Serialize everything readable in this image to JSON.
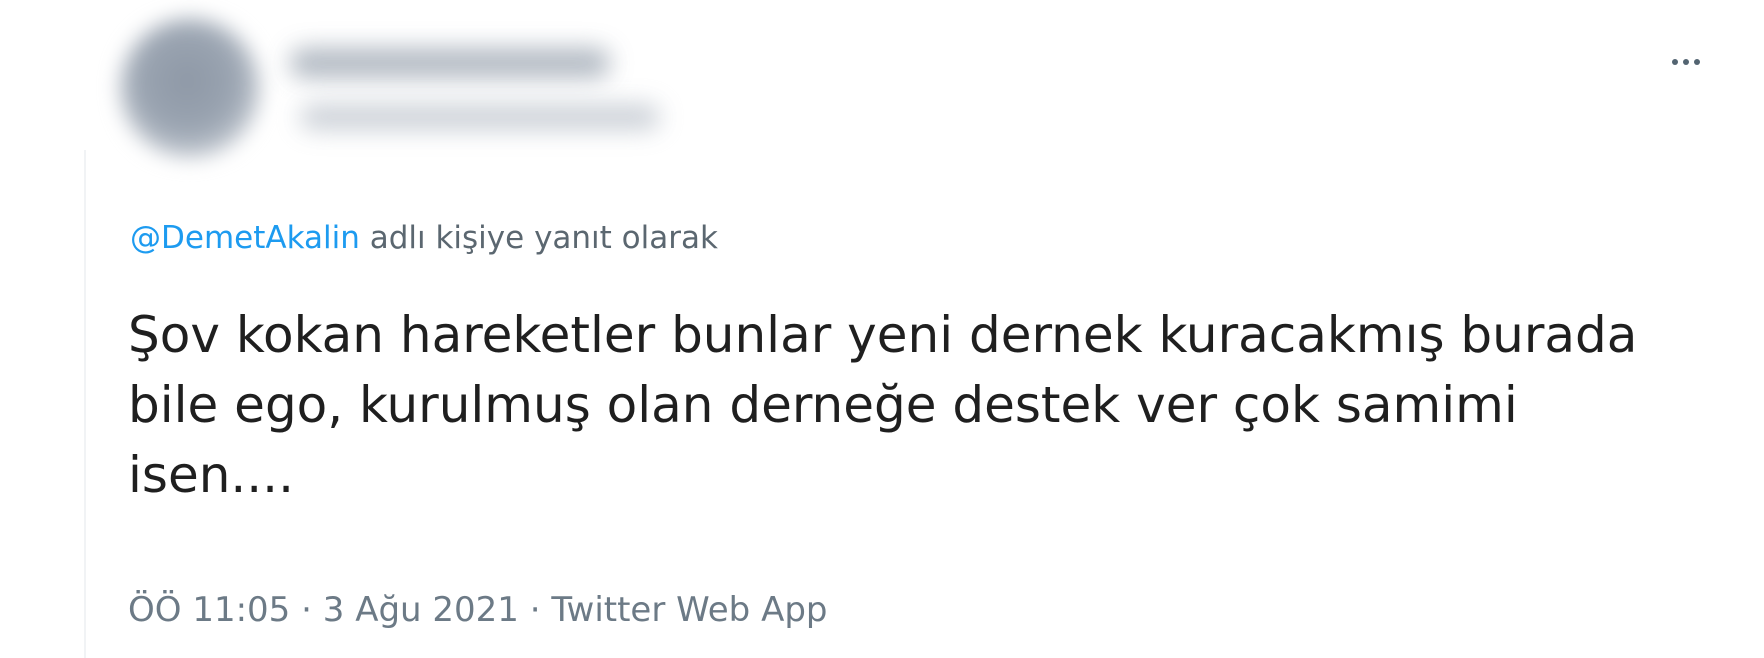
{
  "tweet": {
    "more_icon": "more-horizontal-icon",
    "reply_to": {
      "handle": "@DemetAkalin",
      "suffix": " adlı kişiye yanıt olarak"
    },
    "text": "Şov kokan hareketler bunlar yeni dernek kuracakmış burada bile ego, kurulmuş olan derneğe destek ver çok samimi isen....",
    "meta": {
      "time": "ÖÖ 11:05",
      "separator": " · ",
      "date": "3 Ağu 2021",
      "source": "Twitter Web App"
    }
  },
  "colors": {
    "link": "#1d9bf0",
    "text": "#1f1f1f",
    "muted": "#6c7a86"
  }
}
